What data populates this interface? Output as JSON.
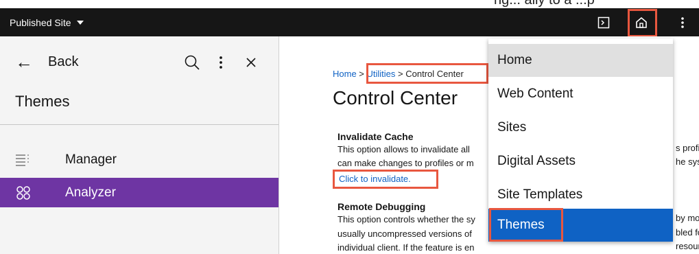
{
  "top_fragment": "ng... ally to a ...p",
  "topbar": {
    "site_label": "Published Site",
    "icons": [
      "terminal-icon",
      "home-icon",
      "overflow-menu-icon"
    ]
  },
  "sidebar": {
    "back_label": "Back",
    "title": "Themes",
    "items": [
      {
        "label": "Manager",
        "icon": "list-icon"
      },
      {
        "label": "Analyzer",
        "icon": "apps-icon"
      }
    ],
    "active_color": "#6e35a3"
  },
  "main": {
    "breadcrumb": {
      "home": "Home",
      "sep1": " > ",
      "utilities": "Utilities",
      "sep2": " > ",
      "current": "Control Center"
    },
    "title": "Control Center",
    "invalidate": {
      "title": "Invalidate Cache",
      "line1": "This option allows to invalidate all",
      "line2": "can make changes to profiles or m",
      "right1": "s profi",
      "right2": "he sys",
      "link": "Click to invalidate."
    },
    "debugging": {
      "title": "Remote Debugging",
      "line1": "This option controls whether the sy",
      "line2": "usually uncompressed versions of",
      "line3": "individual client. If the feature is en",
      "right1": "by mo",
      "right2": "bled fo",
      "right3": "resour"
    }
  },
  "dropdown": {
    "items": [
      "Home",
      "Web Content",
      "Sites",
      "Digital Assets",
      "Site Templates",
      "Themes"
    ],
    "selected": "Themes",
    "selected_color": "#0f62c4"
  },
  "highlight_color": "#e8573f"
}
